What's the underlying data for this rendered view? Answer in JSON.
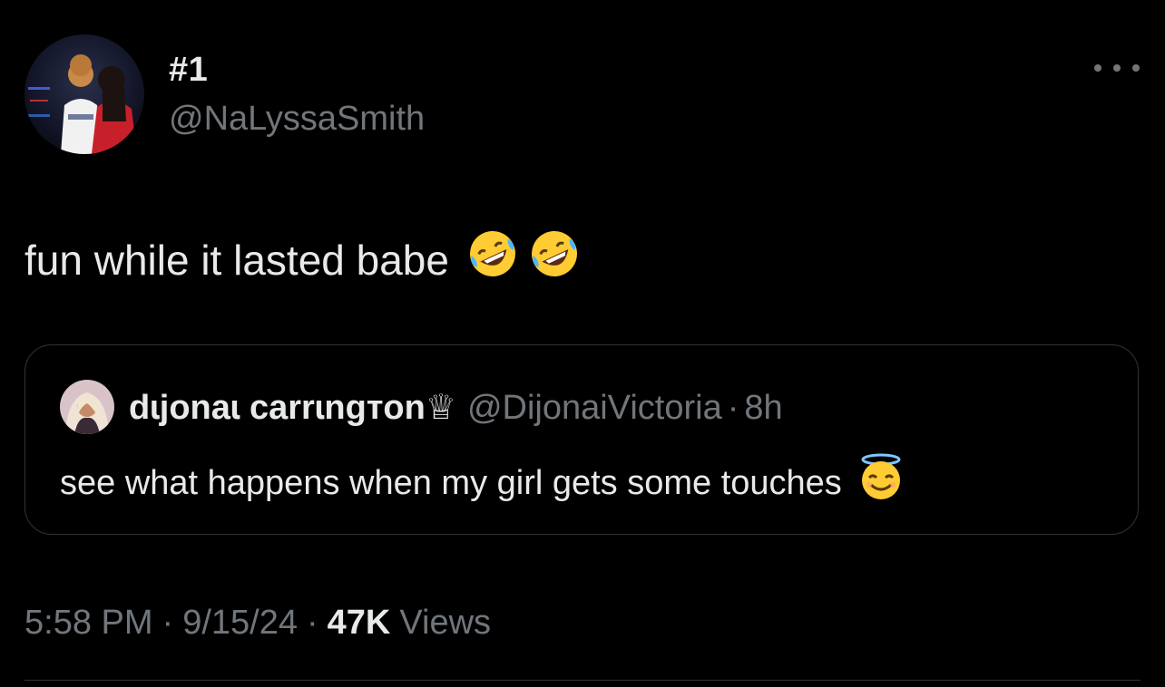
{
  "post": {
    "display_name": "#1",
    "handle": "@NaLyssaSmith",
    "text": "fun while it lasted babe",
    "text_emojis": [
      "rolling-on-floor-laughing-emoji",
      "rolling-on-floor-laughing-emoji"
    ],
    "more_icon": "more-horizontal-icon"
  },
  "quote": {
    "display_name": "dɩjonaɩ carrɩngтon♕",
    "handle": "@DijonaiVictoria",
    "separator": "·",
    "time": "8h",
    "text": "see what happens when my girl gets some touches",
    "text_emoji": "smiling-face-with-halo-emoji"
  },
  "meta": {
    "time": "5:58 PM",
    "separator": "·",
    "date": "9/15/24",
    "views_count": "47K",
    "views_label": "Views"
  },
  "colors": {
    "background": "#000000",
    "text_primary": "#e7e9ea",
    "text_secondary": "#71767b",
    "border": "#2f3336"
  }
}
